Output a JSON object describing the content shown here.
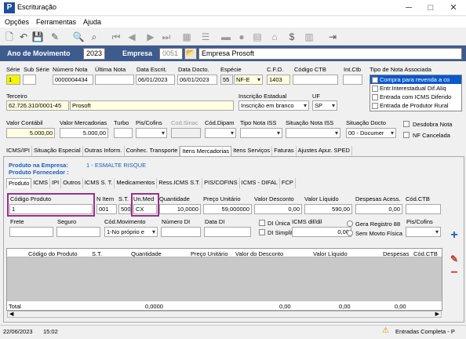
{
  "window": {
    "title": "Escrituração",
    "minimize": "─",
    "maximize": "□",
    "close": "✕"
  },
  "menu": [
    "Opções",
    "Ferramentas",
    "Ajuda"
  ],
  "header": {
    "ano_label": "Ano de Movimento",
    "ano_value": "2023",
    "empresa_label": "Empresa",
    "empresa_code": "0051",
    "empresa_name": "Empresa Prosoft"
  },
  "doc": {
    "labels": {
      "serie": "Série",
      "sub_serie": "Sub Série",
      "numero_nota": "Número Nota",
      "ultima_nota": "Última Nota",
      "data_escrit": "Data Escrit.",
      "data_docto": "Data Docto.",
      "especie": "Espécie",
      "cfo": "C.F.O.",
      "codigo_ctb": "Código CTB",
      "int_ctb": "Int.Ctb",
      "tipo_nota": "Tipo de Nota Associada"
    },
    "serie": "1",
    "sub_serie": "",
    "numero_nota": "0000004434",
    "ultima_nota": "",
    "data_escrit": "06/01/2023",
    "data_docto": "06/01/2023",
    "especie_code": "55",
    "especie_value": "NF-E",
    "cfo": "1403",
    "codigo_ctb": "",
    "int_ctb": ""
  },
  "tipo_nota_options": [
    "Compra para revenda a co",
    "Entr.Interestadual Dif.Aliq",
    "Entrada com ICMS Diferido",
    "Entrada de Produtor Rural"
  ],
  "terceiro": {
    "label": "Terceiro",
    "cnpj": "62.726.310/0001-45",
    "name": "Prosoft",
    "inscricao_label": "Inscrição Estadual",
    "inscricao_value": "Inscrição em branco",
    "uf_label": "UF",
    "uf_value": "SP"
  },
  "valores": {
    "labels": {
      "valor_contabil": "Valor Contábil",
      "valor_mercadorias": "Valor Mercadorias",
      "turbo": "Turbo",
      "pis_cofins": "Pis/Cofins",
      "cod_sinac": "Cod.Sinac",
      "cod_dipam": "Cód.Dipam",
      "tipo_nota_iss": "Tipo Nota ISS",
      "situacao_nota_iss": "Situação Nota ISS",
      "situacao_docto": "Situação Docto"
    },
    "valor_contabil": "5.000,00",
    "valor_mercadorias": "5.000,00",
    "situacao_docto": "00 - Documer",
    "desdobra_nota": "Desdobra Nota",
    "nf_cancelada": "NF Cancelada"
  },
  "main_tabs": [
    "ICMS/IPI",
    "Situação Especial",
    "Outras Inform.",
    "Conhec. Transporte",
    "Itens Mercadorias",
    "Itens Serviços",
    "Faturas",
    "Ajustes Apur. SPED"
  ],
  "produto_empresa_label": "Produto na Empresa:",
  "produto_empresa_value": "1 - ESMALTE RISQUE",
  "produto_fornecedor_label": "Produto Fornecedor :",
  "sub_tabs": [
    "Produto",
    "ICMS",
    "IPI",
    "Outros",
    "ICMS S. T.",
    "Medicamentos",
    "Ress.ICMS S.T.",
    "PIS/COFINS",
    "ICMS - DIFAL",
    "FCP"
  ],
  "produto": {
    "labels": {
      "codigo_produto": "Código Produto",
      "n_item": "N Item",
      "st": "S.T.",
      "un_med": "Un.Med",
      "quantidade": "Quantidade",
      "preco_unitario": "Preço Unitário",
      "valor_desconto": "Valor Desconto",
      "valor_liquido": "Valor Líquido",
      "despesas_acess": "Despesas Acess.",
      "cod_ctb": "Cód.CTB",
      "frete": "Frete",
      "seguro": "Seguro",
      "cod_movimento": "Cód.Movimento",
      "numero_di": "Número DI",
      "data_di": "Data DI",
      "icms_dif": "ICMS dif/dil",
      "pis_cofins": "Pis/Cofins"
    },
    "codigo_produto": "1",
    "n_item": "001",
    "st": "500",
    "un_med": "CX",
    "quantidade": "10,0000",
    "preco_unitario": "59,000000",
    "valor_desconto": "0,00",
    "valor_liquido": "590,00",
    "despesas_acess": "0,00",
    "cod_ctb": "",
    "frete": "",
    "seguro": "",
    "cod_movimento": "1-No próprio e",
    "numero_di": "",
    "data_di": "",
    "icms_dif": "0,00",
    "di_unica": "DI Única",
    "di_simplif": "DI Simplif",
    "gera_registro": "Gera Registro 88",
    "sem_movto": "Sem Movto Física"
  },
  "grid": {
    "headers": [
      "Código do Produto",
      "S.T.",
      "Quantidade",
      "Preço Unitário",
      "Valor do Desconto",
      "Valor Líquido",
      "Despesas",
      "Cód.CTB"
    ],
    "total_label": "Total",
    "total_quantidade": "0,0000",
    "total_desconto": "0,00",
    "total_liquido": "0,00",
    "total_despesas": "0,00"
  },
  "status": {
    "date": "22/06/2023",
    "time": "15:02",
    "message": "Entradas Completa - P"
  },
  "colors": {
    "blue_header": "#3e5b8e",
    "highlight": "#9c2f8f",
    "yellow_field": "#ffffe1",
    "link_blue": "#1a5fb4"
  }
}
